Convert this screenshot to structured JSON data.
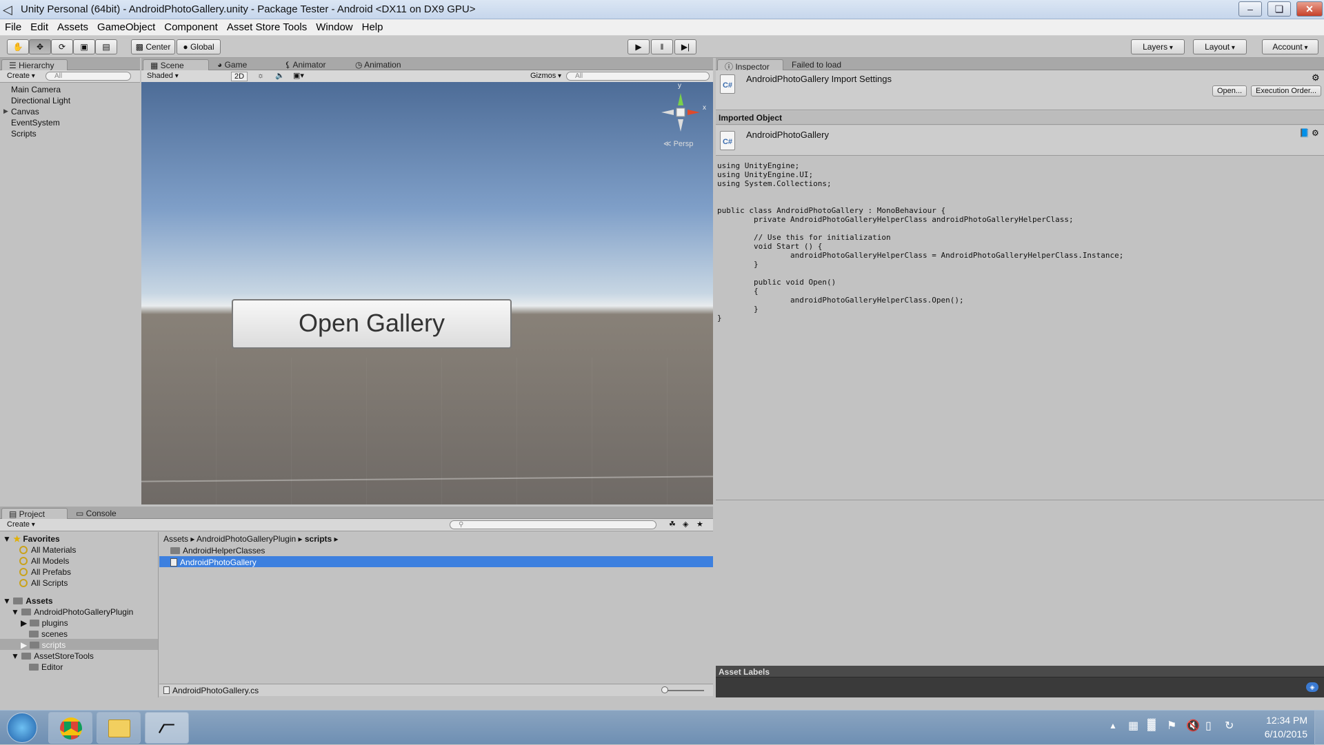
{
  "window": {
    "title": "Unity Personal (64bit) - AndroidPhotoGallery.unity - Package Tester - Android <DX11 on DX9 GPU>",
    "min": "–",
    "restore": "❏",
    "close": "✕"
  },
  "menu": [
    "File",
    "Edit",
    "Assets",
    "GameObject",
    "Component",
    "Asset Store Tools",
    "Window",
    "Help"
  ],
  "toolbar": {
    "center": "Center",
    "global": "Global",
    "layers": "Layers",
    "layout": "Layout",
    "account": "Account",
    "play": "▶",
    "pause": "‖",
    "step": "▶|"
  },
  "hierarchy": {
    "tab": "Hierarchy",
    "create": "Create",
    "search": "All",
    "items": [
      "Main Camera",
      "Directional Light",
      "Canvas",
      "EventSystem",
      "Scripts"
    ]
  },
  "scene": {
    "tabs": [
      "Scene",
      "Game",
      "Animator",
      "Animation"
    ],
    "shading": "Shaded",
    "mode2d": "2D",
    "gizmos": "Gizmos",
    "search": "All",
    "persp": "Persp",
    "gizmo_x": "x",
    "gizmo_y": "y",
    "button_text": "Open Gallery"
  },
  "inspector": {
    "tab": "Inspector",
    "tab2": "Failed to load",
    "header": "AndroidPhotoGallery Import Settings",
    "open_btn": "Open...",
    "exec_btn": "Execution Order...",
    "imported_label": "Imported Object",
    "asset_name": "AndroidPhotoGallery",
    "cs_icon": "C#",
    "asset_labels": "Asset Labels",
    "code": "using UnityEngine;\nusing UnityEngine.UI;\nusing System.Collections;\n\n\npublic class AndroidPhotoGallery : MonoBehaviour {\n\tprivate AndroidPhotoGalleryHelperClass androidPhotoGalleryHelperClass;\n\n\t// Use this for initialization\n\tvoid Start () {\n\t\tandroidPhotoGalleryHelperClass = AndroidPhotoGalleryHelperClass.Instance;\n\t}\n\n\tpublic void Open()\n\t{\n\t\tandroidPhotoGalleryHelperClass.Open();\n\t}\n}"
  },
  "project": {
    "tabs": [
      "Project",
      "Console"
    ],
    "create": "Create",
    "favorites": "Favorites",
    "fav_items": [
      "All Materials",
      "All Models",
      "All Prefabs",
      "All Scripts"
    ],
    "assets": "Assets",
    "tree": [
      {
        "label": "AndroidPhotoGalleryPlugin"
      },
      {
        "label": "plugins"
      },
      {
        "label": "scenes"
      },
      {
        "label": "scripts"
      },
      {
        "label": "AssetStoreTools"
      },
      {
        "label": "Editor"
      }
    ],
    "breadcrumb": [
      "Assets",
      "AndroidPhotoGalleryPlugin",
      "scripts"
    ],
    "files": [
      "AndroidHelperClasses",
      "AndroidPhotoGallery"
    ],
    "status_file": "AndroidPhotoGallery.cs"
  },
  "taskbar": {
    "time": "12:34 PM",
    "date": "6/10/2015"
  }
}
